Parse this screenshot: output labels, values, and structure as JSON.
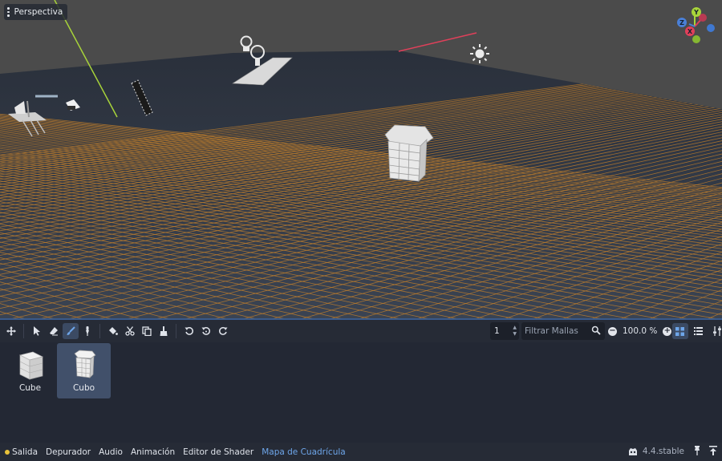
{
  "viewport": {
    "menu_icon": "kebab-menu-icon",
    "mode_label": "Perspectiva",
    "gizmo_axes": {
      "x": "X",
      "y": "Y",
      "z": "Z"
    },
    "colors": {
      "floor_top": "#2e3440",
      "floor_bottom": "#3c4555",
      "grid": "#c8822a",
      "sky": "#4a4a4a",
      "y_axis": "#a8d43a",
      "x_axis": "#e0405a"
    }
  },
  "toolbar": {
    "tools": [
      {
        "name": "transform-icon",
        "active": false
      },
      {
        "name": "select-icon",
        "active": false
      },
      {
        "name": "erase-icon",
        "active": false
      },
      {
        "name": "paint-icon",
        "active": true
      },
      {
        "name": "pick-icon",
        "active": false
      },
      {
        "name": "fill-icon",
        "active": false
      },
      {
        "name": "cut-icon",
        "active": false
      },
      {
        "name": "duplicate-icon",
        "active": false
      },
      {
        "name": "clear-icon",
        "active": false
      },
      {
        "name": "rotate-x-icon",
        "active": false
      },
      {
        "name": "rotate-y-icon",
        "active": false
      },
      {
        "name": "rotate-z-icon",
        "active": false
      }
    ],
    "floor_value": "1",
    "filter_placeholder": "Filtrar Mallas",
    "zoom_value": "100.0 %"
  },
  "library": {
    "items": [
      {
        "label": "Cube",
        "selected": false
      },
      {
        "label": "Cubo",
        "selected": true
      }
    ]
  },
  "bottom": {
    "tabs": [
      {
        "label": "Salida",
        "active": false,
        "status_dot": true
      },
      {
        "label": "Depurador",
        "active": false
      },
      {
        "label": "Audio",
        "active": false
      },
      {
        "label": "Animación",
        "active": false
      },
      {
        "label": "Editor de Shader",
        "active": false
      },
      {
        "label": "Mapa de Cuadrícula",
        "active": true
      }
    ],
    "version": "4.4.stable"
  }
}
